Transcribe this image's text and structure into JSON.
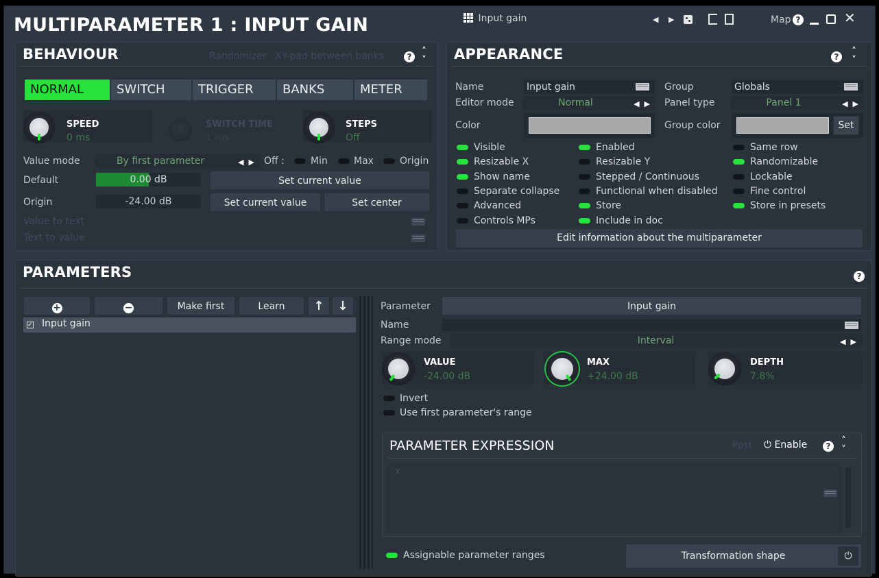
{
  "window": {
    "title": "MULTIPARAMETER 1 : INPUT GAIN",
    "preset_name": "Input gain",
    "map_label": "Map"
  },
  "behaviour": {
    "header": "BEHAVIOUR",
    "randomizer": "Randomizer",
    "xy_pad": "XY-pad between banks",
    "tabs": [
      "NORMAL",
      "SWITCH",
      "TRIGGER",
      "BANKS",
      "METER"
    ],
    "selected_tab": "NORMAL",
    "knobs": [
      {
        "name": "SPEED",
        "value": "0 ms"
      },
      {
        "name": "SWITCH TIME",
        "value": "1 ms"
      },
      {
        "name": "STEPS",
        "value": "Off"
      }
    ],
    "value_mode_label": "Value mode",
    "value_mode": "By first parameter",
    "off_label": "Off :",
    "off_options": [
      "Min",
      "Max",
      "Origin"
    ],
    "default_label": "Default",
    "default_value": "0.00 dB",
    "default_fill": 0.5,
    "origin_label": "Origin",
    "origin_value": "-24.00 dB",
    "set_current_value": "Set current value",
    "set_center": "Set center",
    "value_to_text": "Value to text",
    "text_to_value": "Text to value"
  },
  "appearance": {
    "header": "APPEARANCE",
    "name_label": "Name",
    "name_value": "Input gain",
    "group_label": "Group",
    "group_value": "Globals",
    "editor_mode_label": "Editor mode",
    "editor_mode": "Normal",
    "panel_type_label": "Panel type",
    "panel_type": "Panel 1",
    "color_label": "Color",
    "group_color_label": "Group color",
    "set_label": "Set",
    "toggles": [
      {
        "label": "Visible",
        "on": true
      },
      {
        "label": "Enabled",
        "on": true
      },
      {
        "label": "Same row",
        "on": false
      },
      {
        "label": "Resizable X",
        "on": true
      },
      {
        "label": "Resizable Y",
        "on": false
      },
      {
        "label": "Randomizable",
        "on": true
      },
      {
        "label": "Show name",
        "on": true
      },
      {
        "label": "Stepped / Continuous",
        "on": false
      },
      {
        "label": "Lockable",
        "on": false
      },
      {
        "label": "Separate collapse",
        "on": false
      },
      {
        "label": "Functional when disabled",
        "on": false
      },
      {
        "label": "Fine control",
        "on": false
      },
      {
        "label": "Advanced",
        "on": false
      },
      {
        "label": "Store",
        "on": true
      },
      {
        "label": "Store in presets",
        "on": true
      },
      {
        "label": "Controls MPs",
        "on": false
      },
      {
        "label": "Include in doc",
        "on": true
      }
    ],
    "edit_info": "Edit information about the multiparameter"
  },
  "parameters": {
    "header": "PARAMETERS",
    "make_first": "Make first",
    "learn": "Learn",
    "list": [
      "Input gain"
    ],
    "parameter_label": "Parameter",
    "parameter_value": "Input gain",
    "name_label": "Name",
    "name_value": "",
    "range_mode_label": "Range mode",
    "range_mode": "Interval",
    "knobs": [
      {
        "name": "VALUE",
        "value": "-24.00 dB"
      },
      {
        "name": "MAX",
        "value": "+24.00 dB"
      },
      {
        "name": "DEPTH",
        "value": "7.8%"
      }
    ],
    "invert": "Invert",
    "use_first_range": "Use first parameter's range",
    "expression_header": "PARAMETER EXPRESSION",
    "post_label": "Post",
    "enable_label": "Enable",
    "expression_text": "x",
    "assignable_ranges": "Assignable parameter ranges",
    "transformation_shape": "Transformation shape"
  },
  "colors": {
    "accent_green": "#26e23b",
    "panel_bg": "#2a323b",
    "window_bg": "#2f3842"
  }
}
